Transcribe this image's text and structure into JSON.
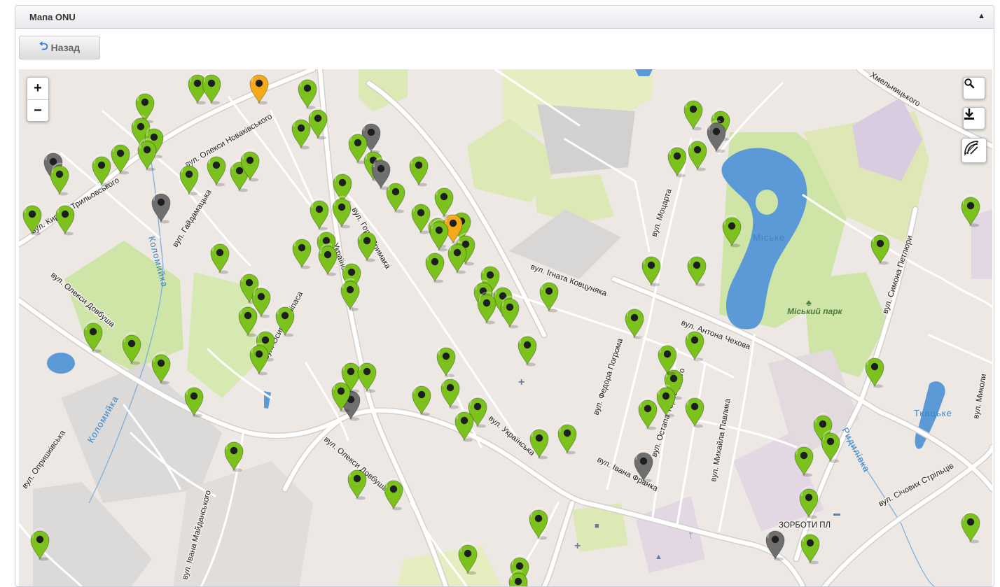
{
  "panel": {
    "title": "Мапа ONU",
    "collapse_icon": "▲"
  },
  "toolbar": {
    "back_label": "Назад",
    "back_icon": "undo-arrow-icon"
  },
  "map": {
    "zoom_in_label": "+",
    "zoom_out_label": "−",
    "controls": [
      "search-icon",
      "download-icon",
      "draw-shape-icon"
    ],
    "colors": {
      "online": "#7cc21c",
      "offline": "#6f6f6f",
      "warning": "#f4a91b",
      "water": "#5b9ad6",
      "park": "#cfe5a8",
      "land": "#ede8e4"
    },
    "streets": [
      {
        "text": "вул. Олекси Новаківського"
      },
      {
        "text": "вул. Кирила Трильовського"
      },
      {
        "text": "вул. Гайдамацька"
      },
      {
        "text": "Коломийка"
      },
      {
        "text": "вул. Олекси Довбуша"
      },
      {
        "text": "Коломийка"
      },
      {
        "text": "вул. Осипа Куріпаса"
      },
      {
        "text": "вул. Опришківська"
      },
      {
        "text": "вул. Івана Майданського"
      },
      {
        "text": "вул. Олекси Довбуша"
      },
      {
        "text": "вул. Українська"
      },
      {
        "text": "вул. Івана Франка"
      },
      {
        "text": "вул. Моцарта"
      },
      {
        "text": "вул. Антона Чехова"
      },
      {
        "text": "вул. Ігната Ковцуняка"
      },
      {
        "text": "вул. Остапа Терлецького"
      },
      {
        "text": "вул. Михайла Павлика"
      },
      {
        "text": "вул. Січових Стрільців"
      },
      {
        "text": "вул. Симона Петлюри"
      },
      {
        "text": "вул. Миколи"
      },
      {
        "text": "Хмельницького"
      },
      {
        "text": "Ридилівка"
      },
      {
        "text": "Ткацьке"
      },
      {
        "text": "Міське"
      },
      {
        "text": "Міський парк"
      },
      {
        "text": "ЗОРБОТИ ПЛ"
      },
      {
        "text": "вул. Федора Погрома"
      },
      {
        "text": "Українська"
      },
      {
        "text": "вул. Гора Примака"
      }
    ],
    "markers": [
      {
        "status": "online"
      },
      {
        "status": "online"
      },
      {
        "status": "warning"
      },
      {
        "status": "online"
      },
      {
        "status": "online"
      },
      {
        "status": "online"
      },
      {
        "status": "online"
      },
      {
        "status": "online"
      },
      {
        "status": "online"
      },
      {
        "status": "offline"
      },
      {
        "status": "online"
      },
      {
        "status": "online"
      },
      {
        "status": "online"
      },
      {
        "status": "online"
      },
      {
        "status": "online"
      },
      {
        "status": "online"
      },
      {
        "status": "online"
      },
      {
        "status": "online"
      },
      {
        "status": "offline"
      },
      {
        "status": "online"
      },
      {
        "status": "online"
      },
      {
        "status": "offline"
      },
      {
        "status": "online"
      },
      {
        "status": "online"
      },
      {
        "status": "online"
      },
      {
        "status": "online"
      },
      {
        "status": "online"
      },
      {
        "status": "offline"
      },
      {
        "status": "online"
      },
      {
        "status": "online"
      },
      {
        "status": "online"
      },
      {
        "status": "online"
      },
      {
        "status": "online"
      },
      {
        "status": "online"
      },
      {
        "status": "online"
      },
      {
        "status": "warning"
      },
      {
        "status": "online"
      },
      {
        "status": "online"
      },
      {
        "status": "online"
      },
      {
        "status": "online"
      },
      {
        "status": "online"
      },
      {
        "status": "online"
      },
      {
        "status": "online"
      },
      {
        "status": "online"
      },
      {
        "status": "online"
      },
      {
        "status": "online"
      },
      {
        "status": "online"
      },
      {
        "status": "online"
      },
      {
        "status": "online"
      },
      {
        "status": "online"
      },
      {
        "status": "online"
      },
      {
        "status": "online"
      },
      {
        "status": "online"
      },
      {
        "status": "online"
      },
      {
        "status": "online"
      },
      {
        "status": "online"
      },
      {
        "status": "online"
      },
      {
        "status": "offline"
      },
      {
        "status": "online"
      },
      {
        "status": "online"
      },
      {
        "status": "online"
      },
      {
        "status": "online"
      },
      {
        "status": "online"
      },
      {
        "status": "online"
      },
      {
        "status": "online"
      },
      {
        "status": "online"
      },
      {
        "status": "online"
      },
      {
        "status": "online"
      },
      {
        "status": "online"
      },
      {
        "status": "online"
      },
      {
        "status": "online"
      },
      {
        "status": "online"
      },
      {
        "status": "online"
      },
      {
        "status": "online"
      },
      {
        "status": "online"
      },
      {
        "status": "online"
      },
      {
        "status": "online"
      },
      {
        "status": "online"
      },
      {
        "status": "online"
      },
      {
        "status": "online"
      },
      {
        "status": "online"
      },
      {
        "status": "online"
      },
      {
        "status": "offline"
      },
      {
        "status": "online"
      },
      {
        "status": "online"
      },
      {
        "status": "online"
      },
      {
        "status": "online"
      },
      {
        "status": "online"
      },
      {
        "status": "online"
      },
      {
        "status": "online"
      },
      {
        "status": "online"
      },
      {
        "status": "online"
      },
      {
        "status": "online"
      },
      {
        "status": "offline"
      },
      {
        "status": "online"
      },
      {
        "status": "online"
      },
      {
        "status": "online"
      },
      {
        "status": "online"
      },
      {
        "status": "online"
      },
      {
        "status": "online"
      },
      {
        "status": "offline"
      },
      {
        "status": "online"
      },
      {
        "status": "online"
      },
      {
        "status": "online"
      },
      {
        "status": "online"
      },
      {
        "status": "online"
      },
      {
        "status": "online"
      },
      {
        "status": "online"
      }
    ]
  }
}
